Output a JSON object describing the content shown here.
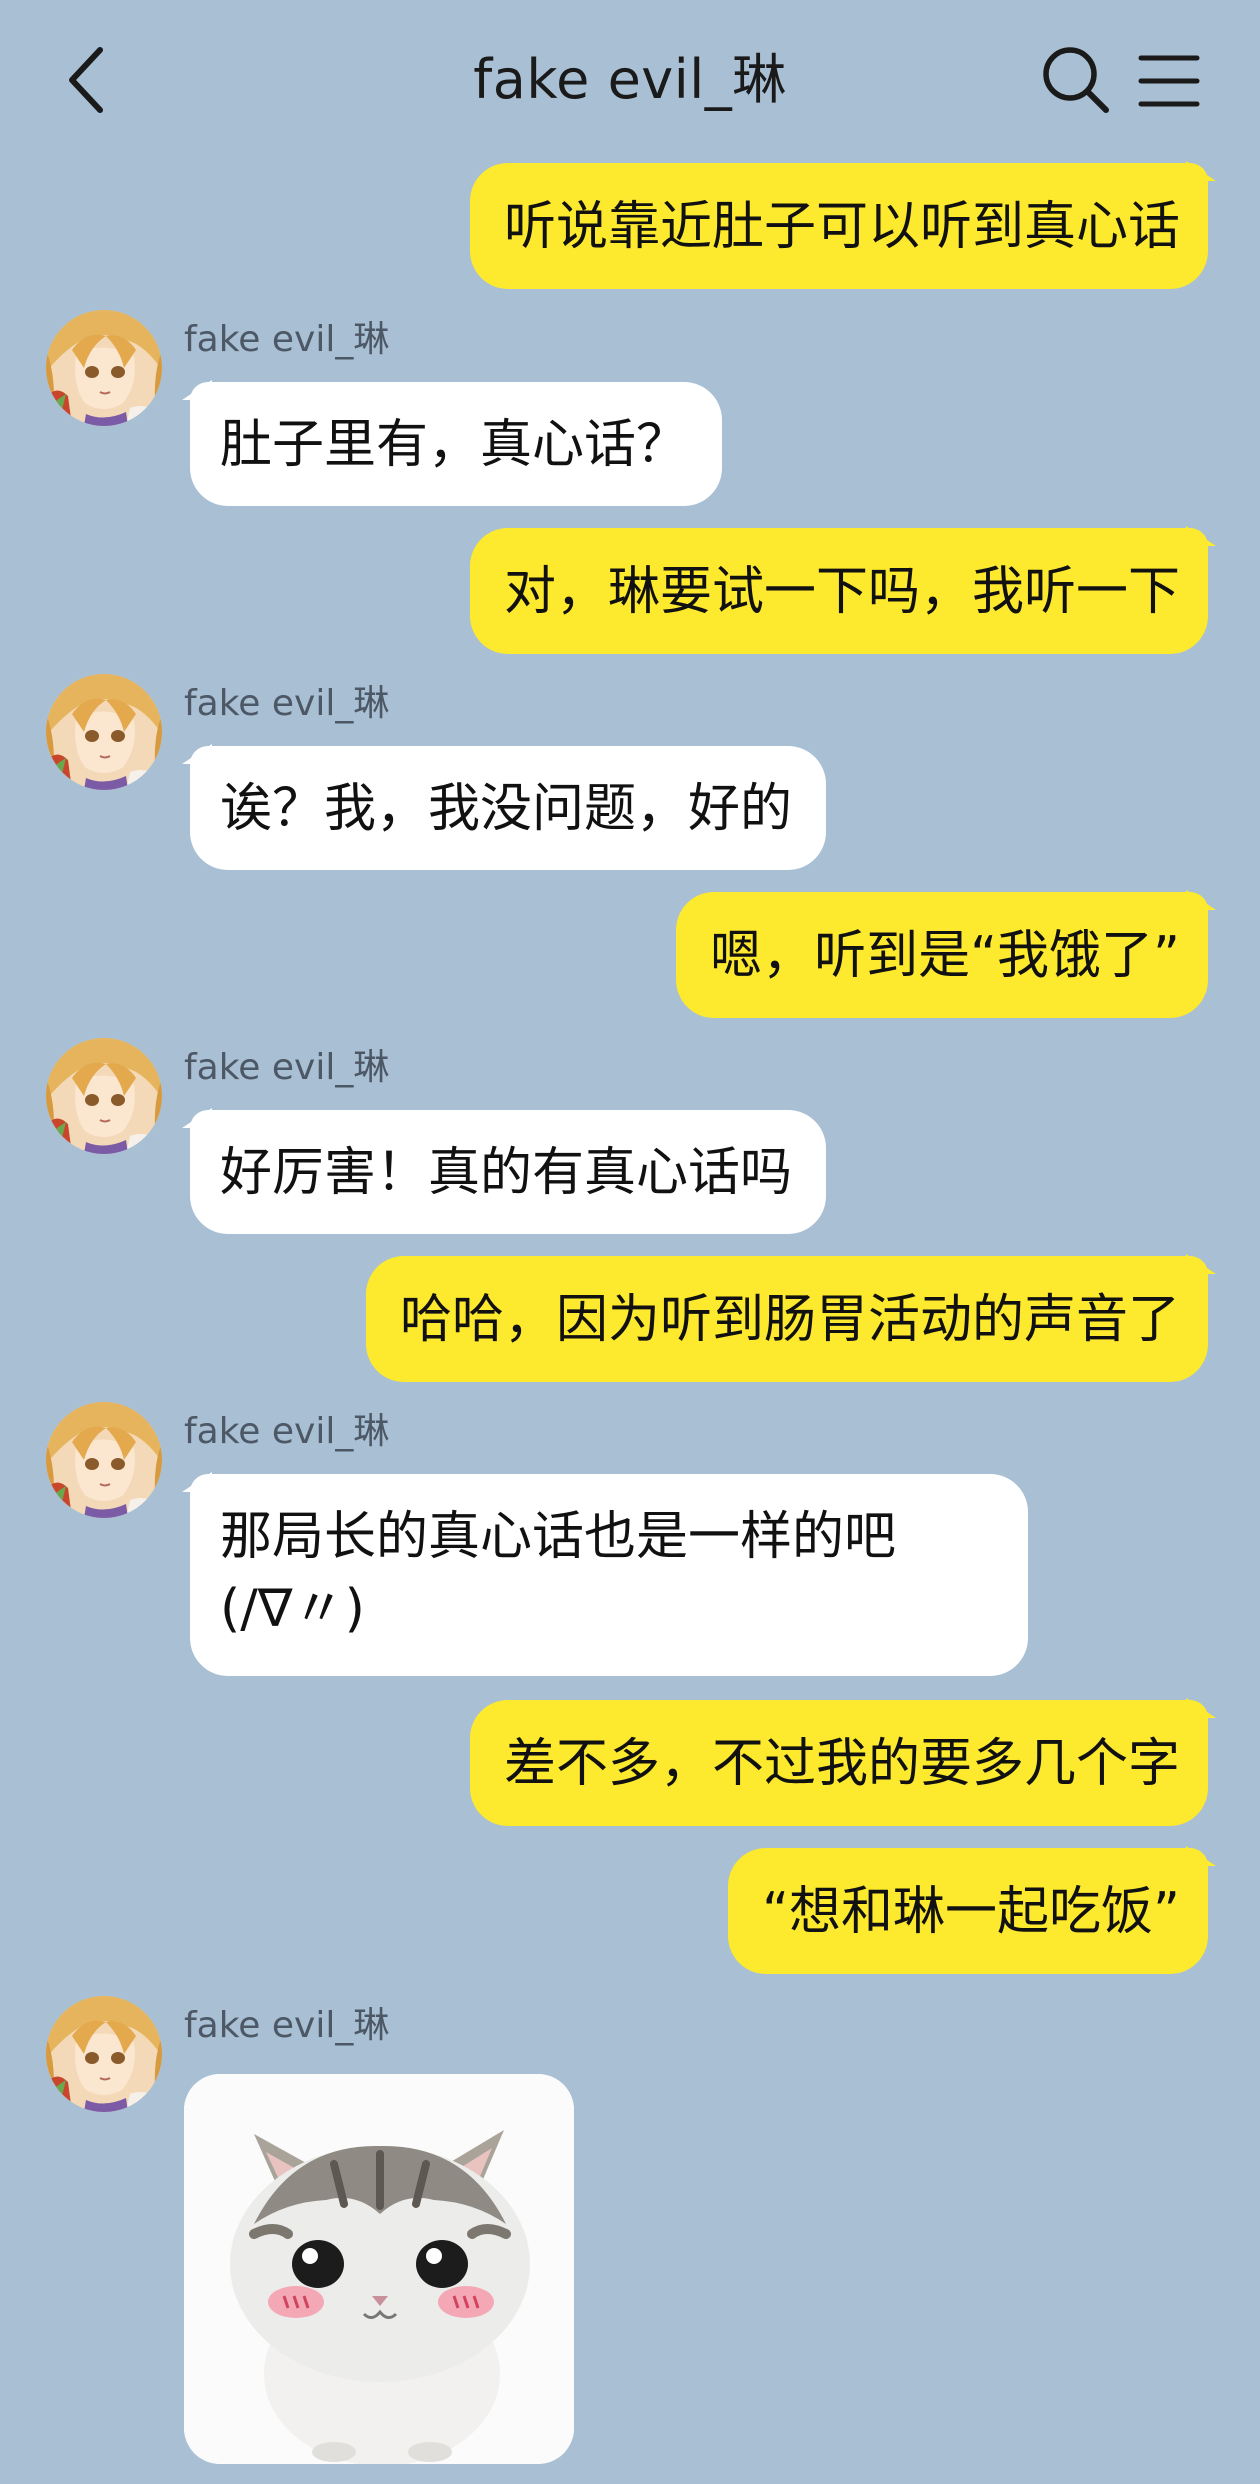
{
  "header": {
    "title": "fake evil_琳",
    "back_icon": "chevron-left-icon",
    "search_icon": "search-icon",
    "menu_icon": "hamburger-menu-icon"
  },
  "colors": {
    "background": "#a9bfd4",
    "sent_bubble": "#fde92d",
    "received_bubble": "#ffffff"
  },
  "messages": [
    {
      "side": "sent",
      "text": "听说靠近肚子可以听到真心话"
    },
    {
      "side": "received",
      "sender": "fake evil_琳",
      "text": "肚子里有，真心话？"
    },
    {
      "side": "sent",
      "text": "对，琳要试一下吗，我听一下"
    },
    {
      "side": "received",
      "sender": "fake evil_琳",
      "text": "诶？我，我没问题，好的"
    },
    {
      "side": "sent",
      "text": "嗯，听到是“我饿了”"
    },
    {
      "side": "received",
      "sender": "fake evil_琳",
      "text": "好厉害！真的有真心话吗"
    },
    {
      "side": "sent",
      "text": "哈哈，因为听到肠胃活动的声音了"
    },
    {
      "side": "received",
      "sender": "fake evil_琳",
      "text_line1": "那局长的真心话也是一样的吧",
      "text_line2": "(/∇〃)"
    },
    {
      "side": "sent",
      "text": "差不多，不过我的要多几个字"
    },
    {
      "side": "sent",
      "text": "“想和琳一起吃饭”"
    },
    {
      "side": "received",
      "sender": "fake evil_琳",
      "sticker": "blushing-cat-sticker"
    }
  ]
}
